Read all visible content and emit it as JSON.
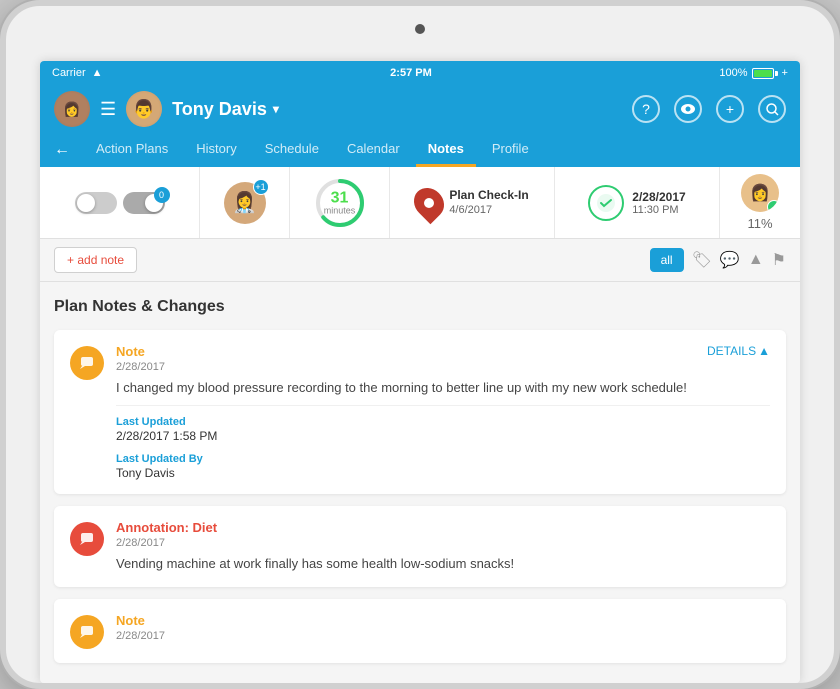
{
  "device": {
    "status_bar": {
      "carrier": "Carrier",
      "time": "2:57 PM",
      "battery": "100%",
      "wifi": true
    }
  },
  "header": {
    "user_name": "Tony Davis",
    "dropdown_label": "Tony Davis",
    "hamburger_label": "☰",
    "icons": {
      "help": "?",
      "eye": "👁",
      "add": "+",
      "search": "🔍"
    }
  },
  "nav": {
    "back_label": "←",
    "items": [
      {
        "label": "Action Plans",
        "active": false
      },
      {
        "label": "History",
        "active": false
      },
      {
        "label": "Schedule",
        "active": false
      },
      {
        "label": "Calendar",
        "active": false
      },
      {
        "label": "Notes",
        "active": true
      },
      {
        "label": "Profile",
        "active": false
      }
    ]
  },
  "summary": {
    "toggle_badge": "+1",
    "circle": {
      "value": "31",
      "label": "minutes"
    },
    "checkin": {
      "label": "Plan Check-In",
      "date": "4/6/2017"
    },
    "checklist": {
      "date": "2/28/2017",
      "time": "11:30 PM"
    },
    "percent": {
      "value": "11%"
    }
  },
  "add_note": {
    "button_label": "+ add note",
    "filter_all": "all"
  },
  "content": {
    "section_title": "Plan Notes & Changes",
    "notes": [
      {
        "id": 1,
        "type": "Note",
        "type_color": "orange",
        "date": "2/28/2017",
        "text": "I changed my blood pressure recording to the morning to better line up with my new work schedule!",
        "details_label": "DETAILS",
        "last_updated_label": "Last Updated",
        "last_updated": "2/28/2017 1:58 PM",
        "last_updated_by_label": "Last Updated By",
        "last_updated_by": "Tony Davis",
        "icon": "💬"
      },
      {
        "id": 2,
        "type": "Annotation: Diet",
        "type_color": "red",
        "date": "2/28/2017",
        "text": "Vending machine at work finally has some health low-sodium snacks!",
        "icon": "💬"
      },
      {
        "id": 3,
        "type": "Note",
        "type_color": "orange",
        "date": "2/28/2017",
        "text": "",
        "icon": "💬"
      }
    ]
  }
}
